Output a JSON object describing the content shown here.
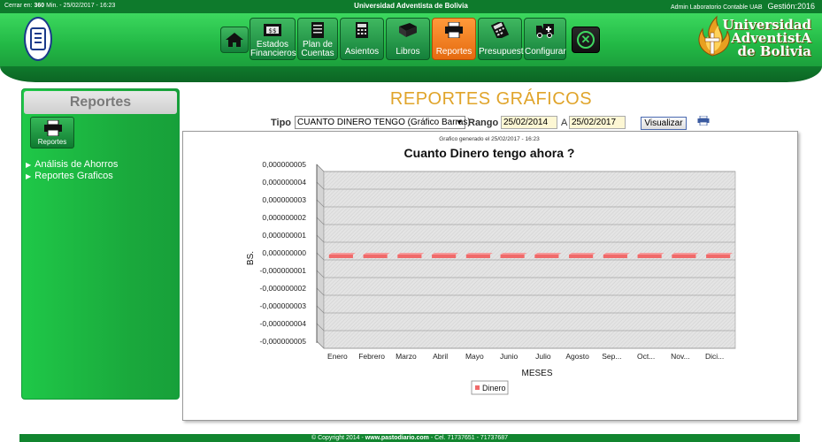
{
  "topbar": {
    "session_prefix": "Cerrar en:",
    "session_minutes": "360",
    "session_suffix": "Min. - 25/02/2017 - 16:23",
    "center_title": "Universidad Adventista de Bolivia",
    "user": "Admin Laboratorio Contable UAB",
    "gestion": "Gestión:2016"
  },
  "brand": {
    "line1": "Universidad",
    "line2": "AdventistA",
    "line3": "de Bolivia"
  },
  "nav": {
    "items": [
      {
        "label": "",
        "icon": "home-icon"
      },
      {
        "label_l1": "Estados",
        "label_l2": "Financieros",
        "icon": "bank-icon"
      },
      {
        "label_l1": "Plan de",
        "label_l2": "Cuentas",
        "icon": "document-icon"
      },
      {
        "label": "Asientos",
        "icon": "calculator-icon"
      },
      {
        "label": "Libros",
        "icon": "book-icon"
      },
      {
        "label": "Reportes",
        "icon": "printer-icon"
      },
      {
        "label": "Presupuesto",
        "icon": "calculator-icon"
      },
      {
        "label": "Configurar",
        "icon": "ambulance-icon"
      },
      {
        "label": "",
        "icon": "close-icon"
      }
    ],
    "active_color": "#f07a1a"
  },
  "sidebar": {
    "title": "Reportes",
    "report_button": "Reportes",
    "links": [
      "Análisis de Ahorros",
      "Reportes Graficos"
    ]
  },
  "main": {
    "page_title": "REPORTES GRÁFICOS",
    "tipo_label": "Tipo :",
    "tipo_value": "CUANTO DINERO TENGO (Gráfico Barras)",
    "rango_label": "Rango :",
    "date_from": "25/02/2014",
    "a_label": "A",
    "date_to": "25/02/2017",
    "visualize_button": "Visualizar"
  },
  "chart_data": {
    "type": "bar",
    "generated_note": "Grafico generado el 25/02/2017 - 16:23",
    "title": "Cuanto Dinero tengo ahora ?",
    "xlabel": "MESES",
    "ylabel": "BS.",
    "categories": [
      "Enero",
      "Febrero",
      "Marzo",
      "Abril",
      "Mayo",
      "Junio",
      "Julio",
      "Agosto",
      "Sep...",
      "Oct...",
      "Nov...",
      "Dici..."
    ],
    "series": [
      {
        "name": "Dinero",
        "values": [
          0,
          0,
          0,
          0,
          0,
          0,
          0,
          0,
          0,
          0,
          0,
          0
        ],
        "color": "#f06a6a"
      }
    ],
    "ylim": [
      -5e-09,
      5e-09
    ],
    "y_ticks": [
      "0,000000005",
      "0,000000004",
      "0,000000003",
      "0,000000002",
      "0,000000001",
      "0,000000000",
      "-0,000000001",
      "-0,000000002",
      "-0,000000003",
      "-0,000000004",
      "-0,000000005"
    ],
    "grid": true,
    "legend": "bottom-center"
  },
  "footer": {
    "copyright": "© Copyright 2014 - ",
    "site": "www.pastodiario.com",
    "phones": " - Cel. 71737651 - 71737687"
  }
}
